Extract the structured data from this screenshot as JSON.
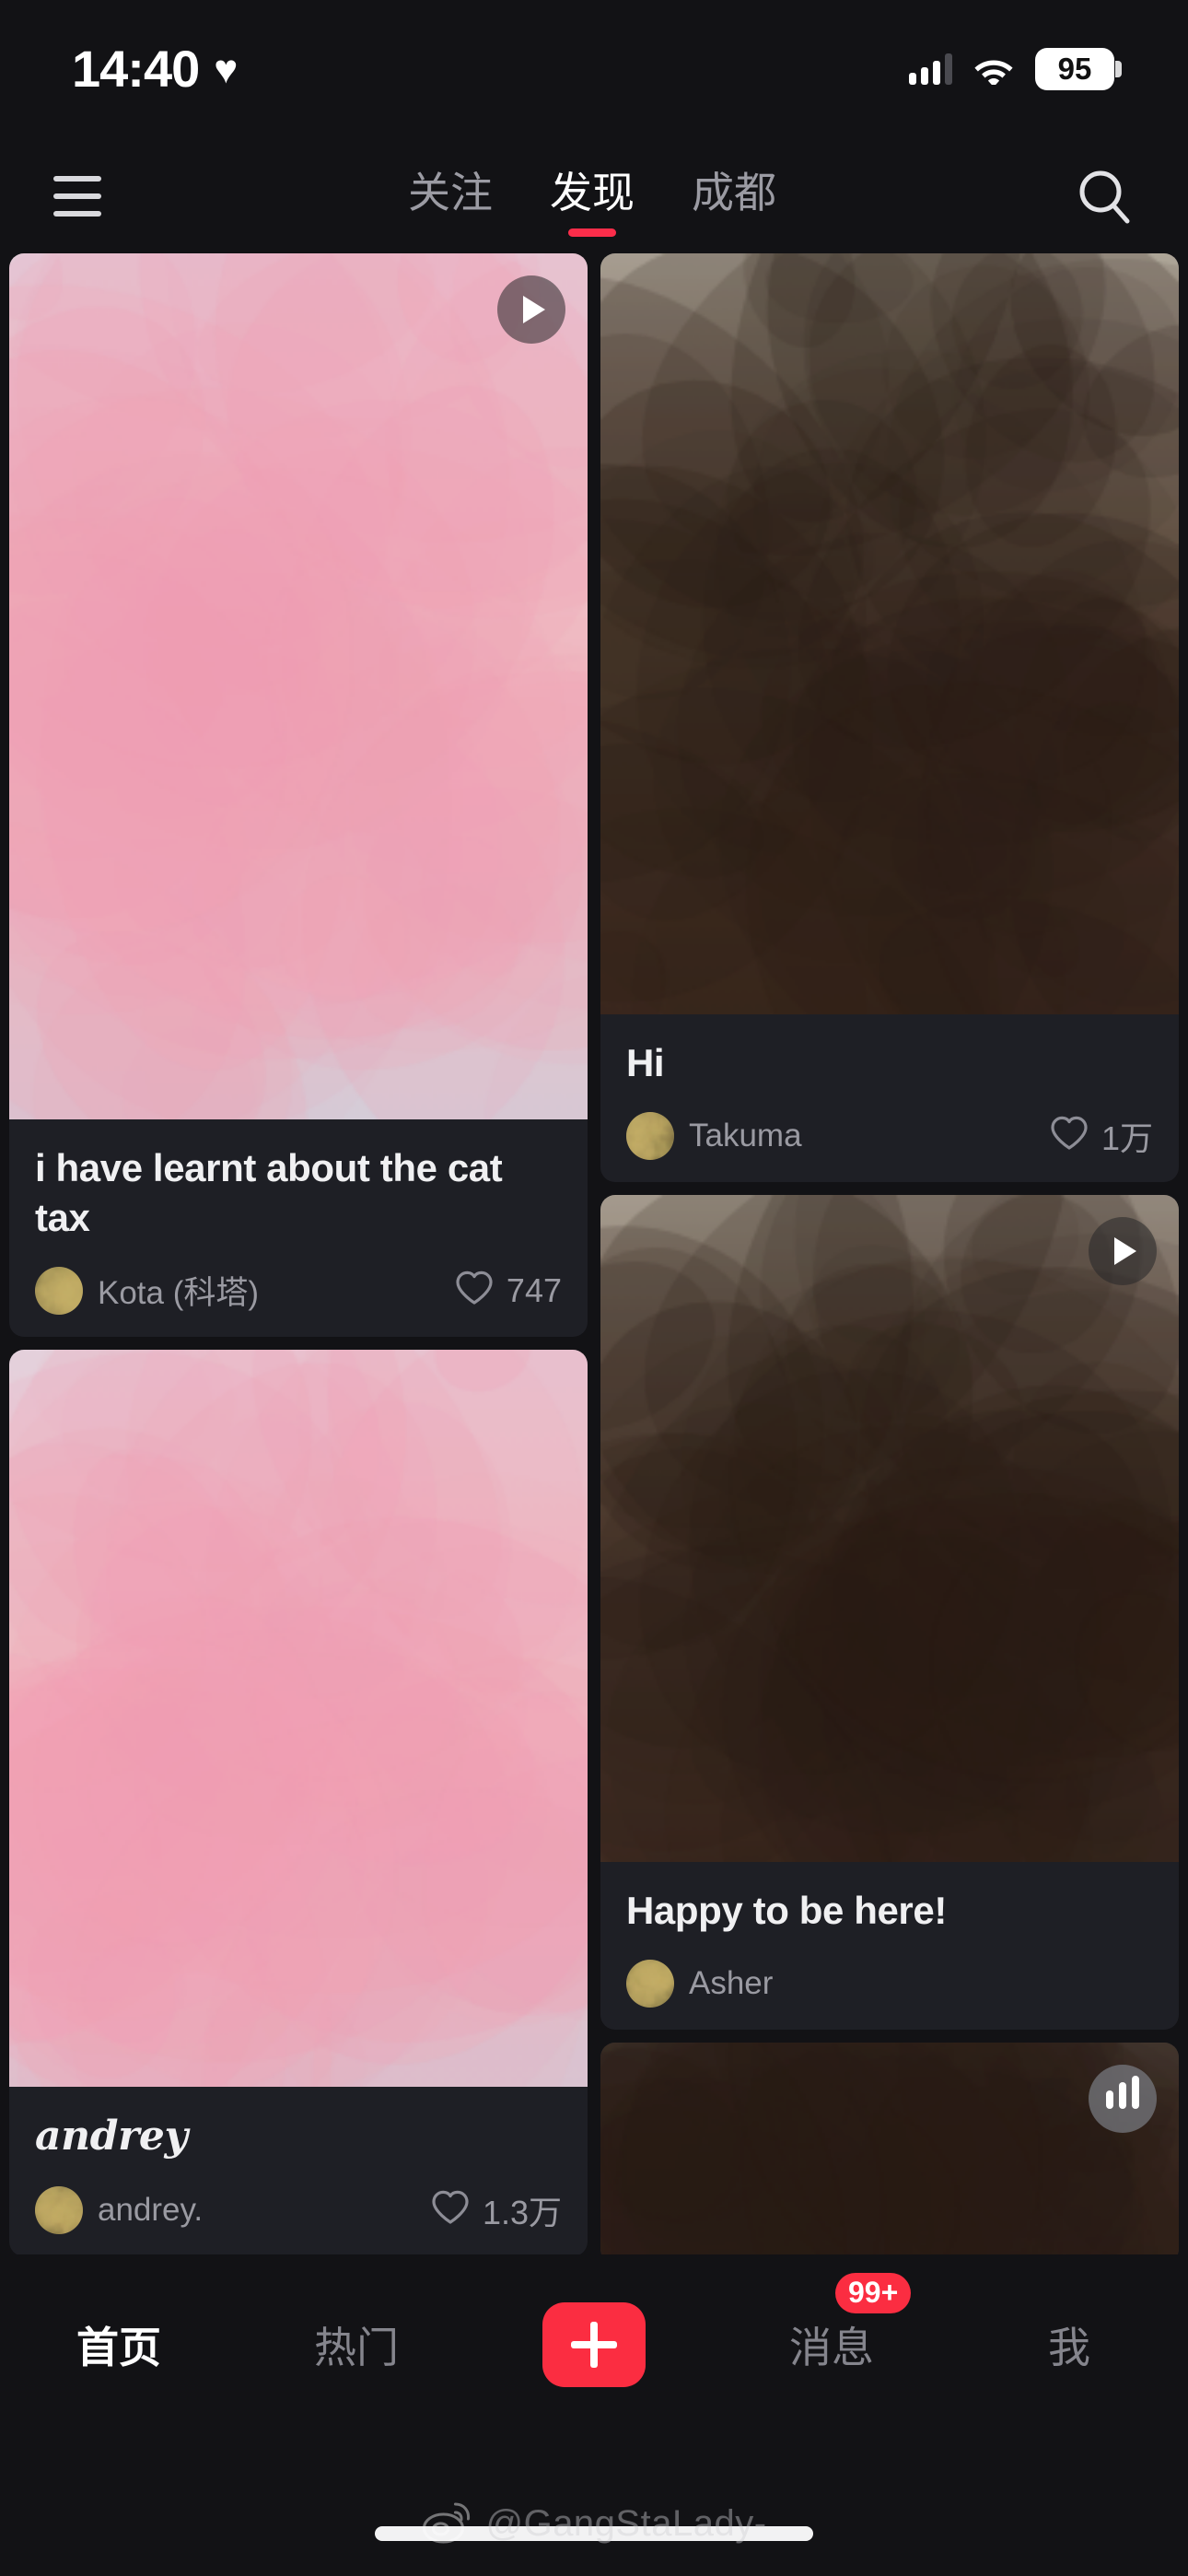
{
  "status_bar": {
    "time": "14:40",
    "heart_icon": "heart-icon",
    "signal_icon": "cellular-bars-icon",
    "wifi_icon": "wifi-icon",
    "battery_level": "95"
  },
  "nav": {
    "menu_icon": "hamburger-menu-icon",
    "search_icon": "search-icon",
    "tabs": [
      {
        "label": "关注",
        "active": false
      },
      {
        "label": "发现",
        "active": true
      },
      {
        "label": "成都",
        "active": false
      }
    ],
    "accent_color": "#fb2d4a"
  },
  "feed": {
    "columns": [
      {
        "cards": [
          {
            "title": "i have learnt about the cat tax",
            "title_style": "sans",
            "author": "Kota (科塔)",
            "likes": "747",
            "like_icon": "heart-outline-icon",
            "overlay_icon": "play-icon",
            "thumb_h": 940,
            "thumb_seed": 11
          },
          {
            "title": "andrey",
            "title_style": "script",
            "author": "andrey.",
            "likes": "1.3万",
            "like_icon": "heart-outline-icon",
            "overlay_icon": "none",
            "thumb_h": 800,
            "thumb_seed": 23
          },
          {
            "title": "",
            "title_style": "sans",
            "author": "",
            "likes": "",
            "like_icon": "",
            "overlay_icon": "play-icon",
            "thumb_h": 240,
            "thumb_seed": 37
          }
        ]
      },
      {
        "cards": [
          {
            "title": "Hi",
            "title_style": "sans",
            "author": "Takuma",
            "likes": "1万",
            "like_icon": "heart-outline-icon",
            "overlay_icon": "none",
            "thumb_h": 826,
            "thumb_seed": 5
          },
          {
            "title": "Happy to be here!",
            "title_style": "sans",
            "author": "Asher",
            "likes": "",
            "like_icon": "",
            "overlay_icon": "play-icon",
            "thumb_h": 724,
            "thumb_seed": 41
          },
          {
            "title": "",
            "title_style": "sans",
            "author": "",
            "likes": "",
            "like_icon": "",
            "overlay_icon": "wave-icon",
            "thumb_h": 240,
            "thumb_seed": 53
          }
        ]
      }
    ]
  },
  "tabbar": {
    "items": [
      {
        "label": "首页",
        "active": true,
        "type": "text",
        "badge": ""
      },
      {
        "label": "热门",
        "active": false,
        "type": "text",
        "badge": ""
      },
      {
        "label": "",
        "active": false,
        "type": "plus",
        "badge": ""
      },
      {
        "label": "消息",
        "active": false,
        "type": "text",
        "badge": "99+"
      },
      {
        "label": "我",
        "active": false,
        "type": "text",
        "badge": ""
      }
    ],
    "plus_icon": "plus-icon",
    "plus_color": "#fb2d41",
    "badge_color": "#fb2d41"
  },
  "watermark": {
    "text": "@GangStaLady-",
    "logo_icon": "weibo-eye-icon"
  }
}
